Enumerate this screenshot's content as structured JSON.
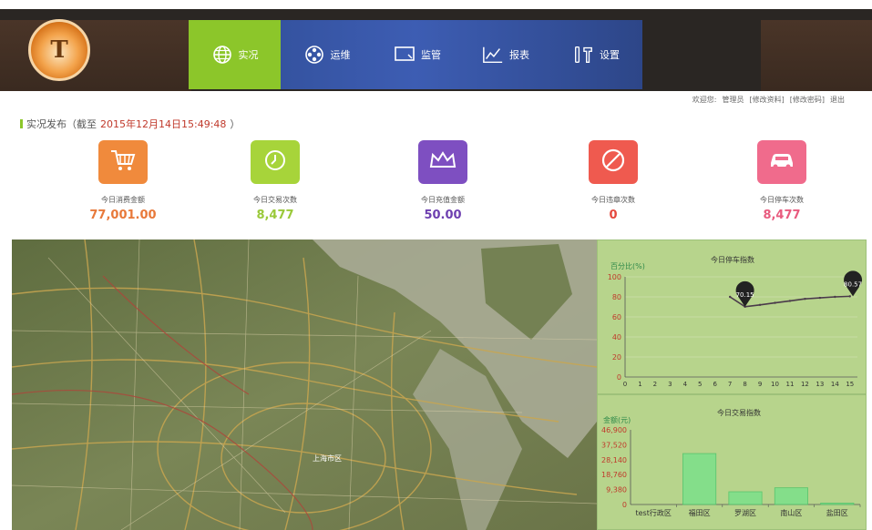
{
  "logo": {
    "mark": "T",
    "icon": "logo-emblem"
  },
  "nav": {
    "items": [
      {
        "label": "实况",
        "icon": "globe-icon",
        "active": true
      },
      {
        "label": "运维",
        "icon": "film-reel-icon",
        "active": false
      },
      {
        "label": "监管",
        "icon": "monitor-icon",
        "active": false
      },
      {
        "label": "报表",
        "icon": "line-chart-icon",
        "active": false
      },
      {
        "label": "设置",
        "icon": "tools-icon",
        "active": false
      }
    ]
  },
  "userbar": {
    "welcome": "欢迎您:",
    "user": "管理员",
    "edit_profile": "[修改资料]",
    "change_password": "[修改密码]",
    "logout": "退出"
  },
  "live": {
    "prefix": "实况发布（截至",
    "timestamp": "2015年12月14日15:49:48",
    "suffix": "）"
  },
  "stats": [
    {
      "label": "今日消费金额",
      "value": "77,001.00",
      "color": "#f08a3c",
      "value_color": "#e8793a",
      "icon": "cart-icon"
    },
    {
      "label": "今日交易次数",
      "value": "8,477",
      "color": "#a7d43a",
      "value_color": "#9ac93a",
      "icon": "clock-icon"
    },
    {
      "label": "今日充值金额",
      "value": "50.00",
      "color": "#7e4fc1",
      "value_color": "#6d3fb0",
      "icon": "crown-icon"
    },
    {
      "label": "今日违章次数",
      "value": "0",
      "color": "#ef5a4f",
      "value_color": "#e5483d",
      "icon": "prohibited-icon"
    },
    {
      "label": "今日停车次数",
      "value": "8,477",
      "color": "#f06b8c",
      "value_color": "#e85a7e",
      "icon": "car-icon"
    }
  ],
  "map": {
    "center_label": "上海市区"
  },
  "chart_data": [
    {
      "type": "line",
      "title": "今日停车指数",
      "ylabel": "百分比(%)",
      "x": [
        0,
        1,
        2,
        3,
        4,
        5,
        6,
        7,
        8,
        9,
        10,
        11,
        12,
        13,
        14,
        15
      ],
      "values": [
        null,
        null,
        null,
        null,
        null,
        null,
        null,
        80.0,
        70.15,
        72,
        74,
        76,
        78,
        79,
        80,
        80.57
      ],
      "ylim": [
        0,
        100
      ],
      "yticks": [
        0,
        20,
        40,
        60,
        80,
        100
      ],
      "markers": [
        {
          "x": 8,
          "value": "70.15"
        },
        {
          "x": 15.2,
          "value": "80.57"
        }
      ]
    },
    {
      "type": "bar",
      "title": "今日交易指数",
      "ylabel": "金额(元)",
      "categories": [
        "test行政区",
        "福田区",
        "罗湖区",
        "南山区",
        "盐田区"
      ],
      "values": [
        0,
        32000,
        8000,
        10500,
        900
      ],
      "ylim": [
        0,
        46900
      ],
      "yticks": [
        0,
        9380,
        18760,
        28140,
        37520,
        46900
      ],
      "ytick_labels": [
        "0",
        "9,380",
        "18,760",
        "28,140",
        "37,520",
        "46,900"
      ]
    }
  ]
}
